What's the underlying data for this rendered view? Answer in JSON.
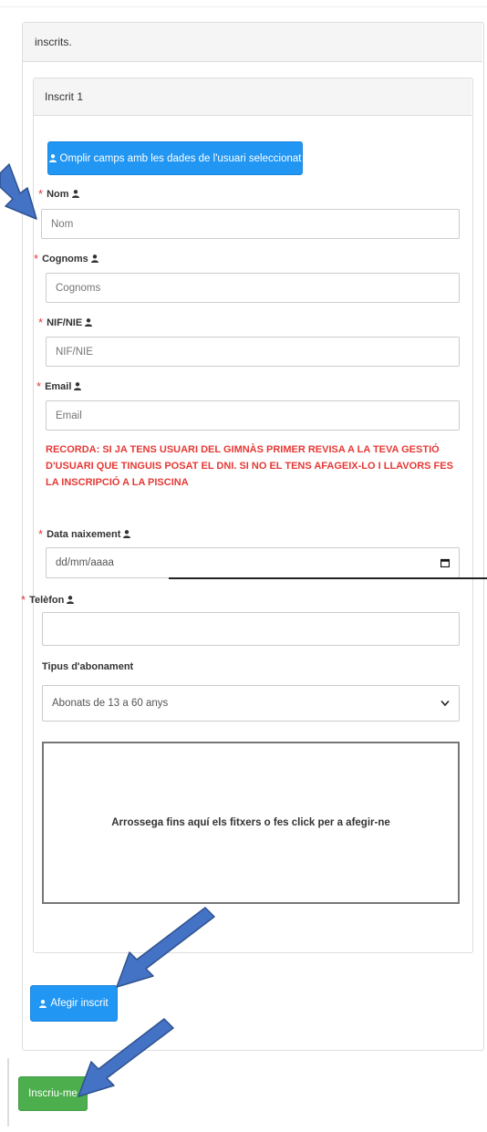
{
  "panel": {
    "title": "inscrits."
  },
  "subscriber": {
    "title": "Inscrit 1",
    "fill_button_label": "Omplir camps amb les dades de l'usuari seleccionat"
  },
  "fields": {
    "nom": {
      "label": "Nom",
      "placeholder": "Nom",
      "required_mark": "*"
    },
    "cognoms": {
      "label": "Cognoms",
      "placeholder": "Cognoms",
      "required_mark": "*"
    },
    "nif": {
      "label": "NIF/NIE",
      "placeholder": "NIF/NIE",
      "required_mark": "*"
    },
    "email": {
      "label": "Email",
      "placeholder": "Email",
      "required_mark": "*"
    },
    "birth": {
      "label": "Data naixement",
      "placeholder": "dd/mm/aaaa",
      "required_mark": "*"
    },
    "phone": {
      "label": "Telèfon",
      "value": "",
      "required_mark": "*"
    },
    "subscription": {
      "label": "Tipus d'abonament",
      "selected": "Abonats de 13 a 60 anys"
    }
  },
  "warning_text": "RECORDA: SI JA TENS USUARI DEL GIMNÀS PRIMER REVISA A LA TEVA GESTIÓ D'USUARI QUE TINGUIS POSAT EL DNI. SI NO EL TENS AFAGEIX-LO I LLAVORS FES LA INSCRIPCIÓ A LA PISCINA",
  "dropzone_text": "Arrossega fins aquí els fitxers o fes click per a afegir-ne",
  "buttons": {
    "add_subscriber": "Afegir inscrit",
    "submit": "Inscriu-me"
  },
  "colors": {
    "primary_blue": "#2196f3",
    "success_green": "#4cae4c",
    "required_red": "#e53935",
    "annotation_arrow": "#4472c4"
  }
}
